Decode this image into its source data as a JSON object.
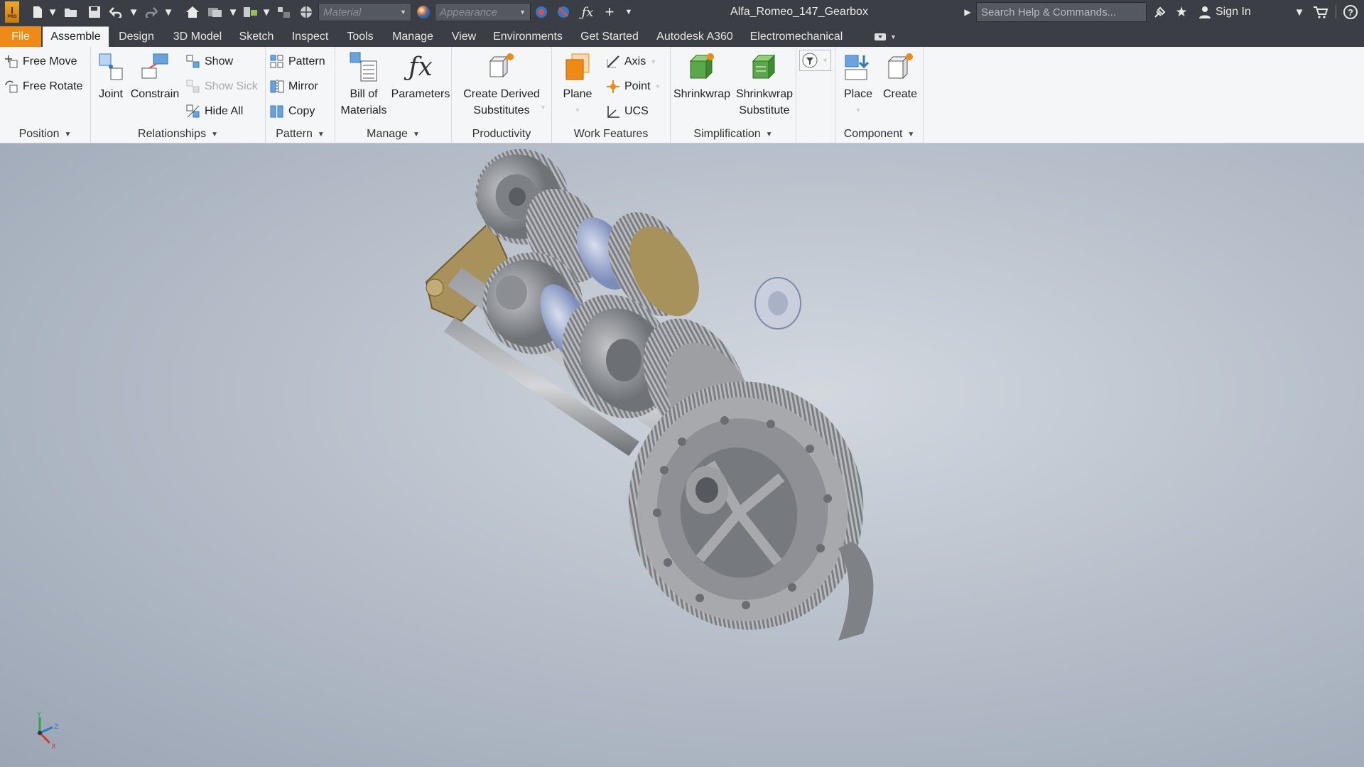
{
  "app": {
    "logo_text": "I",
    "logo_sub": "PRO",
    "document_title": "Alfa_Romeo_147_Gearbox"
  },
  "quick_access": {
    "material_placeholder": "Material",
    "appearance_placeholder": "Appearance",
    "search_placeholder": "Search Help & Commands...",
    "sign_in": "Sign In",
    "help": "?"
  },
  "tabs": [
    "File",
    "Assemble",
    "Design",
    "3D Model",
    "Sketch",
    "Inspect",
    "Tools",
    "Manage",
    "View",
    "Environments",
    "Get Started",
    "Autodesk A360",
    "Electromechanical"
  ],
  "active_tab": "Assemble",
  "ribbon": {
    "position": {
      "title": "Position",
      "free_move": "Free Move",
      "free_rotate": "Free Rotate"
    },
    "relationships": {
      "title": "Relationships",
      "joint": "Joint",
      "constrain": "Constrain",
      "show": "Show",
      "show_sick": "Show Sick",
      "hide_all": "Hide All"
    },
    "pattern": {
      "title": "Pattern",
      "pattern": "Pattern",
      "mirror": "Mirror",
      "copy": "Copy"
    },
    "manage": {
      "title": "Manage",
      "bom_line1": "Bill of",
      "bom_line2": "Materials",
      "parameters": "Parameters"
    },
    "productivity": {
      "title": "Productivity",
      "derived_line1": "Create Derived",
      "derived_line2": "Substitutes"
    },
    "work_features": {
      "title": "Work Features",
      "plane": "Plane",
      "axis": "Axis",
      "point": "Point",
      "ucs": "UCS"
    },
    "simplification": {
      "title": "Simplification",
      "shrinkwrap": "Shrinkwrap",
      "shrinkwrap_sub_line1": "Shrinkwrap",
      "shrinkwrap_sub_line2": "Substitute"
    },
    "component": {
      "title": "Component",
      "place": "Place",
      "create": "Create"
    }
  },
  "viewcube_triad": {
    "x": "X",
    "y": "Y",
    "z": "Z"
  },
  "colors": {
    "titlebar": "#3b3e44",
    "file_tab": "#f08a16",
    "ribbon": "#f5f6f7",
    "accent_blue": "#2f78c4"
  }
}
